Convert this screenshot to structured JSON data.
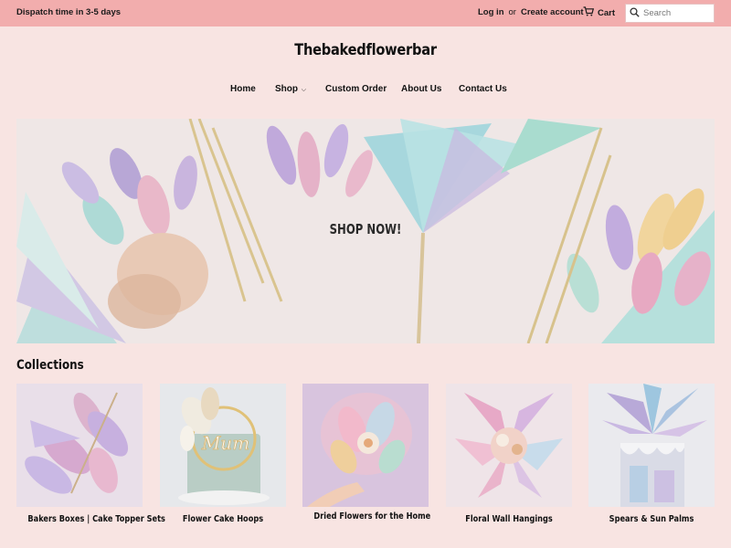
{
  "announcement": {
    "text": "Dispatch time in 3-5 days"
  },
  "account": {
    "login": "Log in",
    "or": "or",
    "create": "Create account"
  },
  "cart": {
    "label": "Cart",
    "icon": "cart-icon"
  },
  "search": {
    "placeholder": "Search",
    "value": "",
    "icon": "search-icon"
  },
  "logo": {
    "text": "Thebakedflowerbar"
  },
  "nav": {
    "items": [
      {
        "label": "Home"
      },
      {
        "label": "Shop",
        "dropdown": true,
        "caret": "⌵"
      },
      {
        "label": "Custom Order"
      },
      {
        "label": "About Us"
      },
      {
        "label": "Contact Us"
      }
    ]
  },
  "hero": {
    "cta": "SHOP NOW!"
  },
  "collections": {
    "title": "Collections",
    "items": [
      {
        "label": "Bakers Boxes | Cake Topper Sets"
      },
      {
        "label": "Flower Cake Hoops",
        "topper_text": "Mum"
      },
      {
        "label": "Dried Flowers for the Home"
      },
      {
        "label": "Floral Wall Hangings"
      },
      {
        "label": "Spears & Sun Palms"
      }
    ]
  },
  "colors": {
    "topbar": "#f2adad",
    "page_background": "#f8e4e2",
    "text": "#111111"
  }
}
